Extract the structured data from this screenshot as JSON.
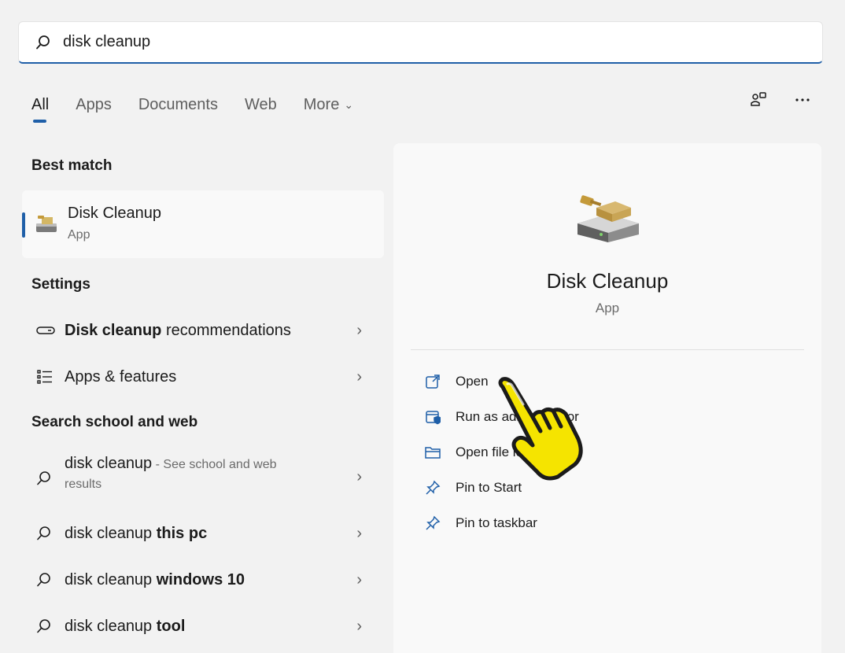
{
  "search": {
    "value": "disk cleanup",
    "icon": "search-icon"
  },
  "tabs": [
    {
      "label": "All",
      "active": true
    },
    {
      "label": "Apps"
    },
    {
      "label": "Documents"
    },
    {
      "label": "Web"
    },
    {
      "label": "More"
    }
  ],
  "top_icons": [
    "account-switch-icon",
    "more-options-icon"
  ],
  "left": {
    "best_match_title": "Best match",
    "best_match": {
      "name": "Disk Cleanup",
      "type": "App",
      "icon": "disk-cleanup-icon"
    },
    "settings_title": "Settings",
    "settings": [
      {
        "bold": "Disk cleanup",
        "rest": " recommendations",
        "icon": "storage-icon"
      },
      {
        "bold": "",
        "rest": "Apps & features",
        "icon": "list-icon"
      }
    ],
    "web_title": "Search school and web",
    "web": [
      {
        "normal": "disk cleanup",
        "hint": " - See school and web",
        "hint2": "results"
      },
      {
        "normal": "disk cleanup ",
        "bold": "this pc"
      },
      {
        "normal": "disk cleanup ",
        "bold": "windows 10"
      },
      {
        "normal": "disk cleanup ",
        "bold": "tool"
      }
    ]
  },
  "right": {
    "name": "Disk Cleanup",
    "type": "App",
    "actions": [
      {
        "label": "Open",
        "icon": "open-external-icon"
      },
      {
        "label": "Run as administrator",
        "icon": "shield-window-icon"
      },
      {
        "label": "Open file location",
        "icon": "folder-icon"
      },
      {
        "label": "Pin to Start",
        "icon": "pin-icon"
      },
      {
        "label": "Pin to taskbar",
        "icon": "pin-icon"
      }
    ]
  },
  "colors": {
    "accent": "#1f5fa8",
    "background": "#f2f2f2",
    "panel": "#f9f9f9",
    "pointer_hand": "#f5e400"
  }
}
